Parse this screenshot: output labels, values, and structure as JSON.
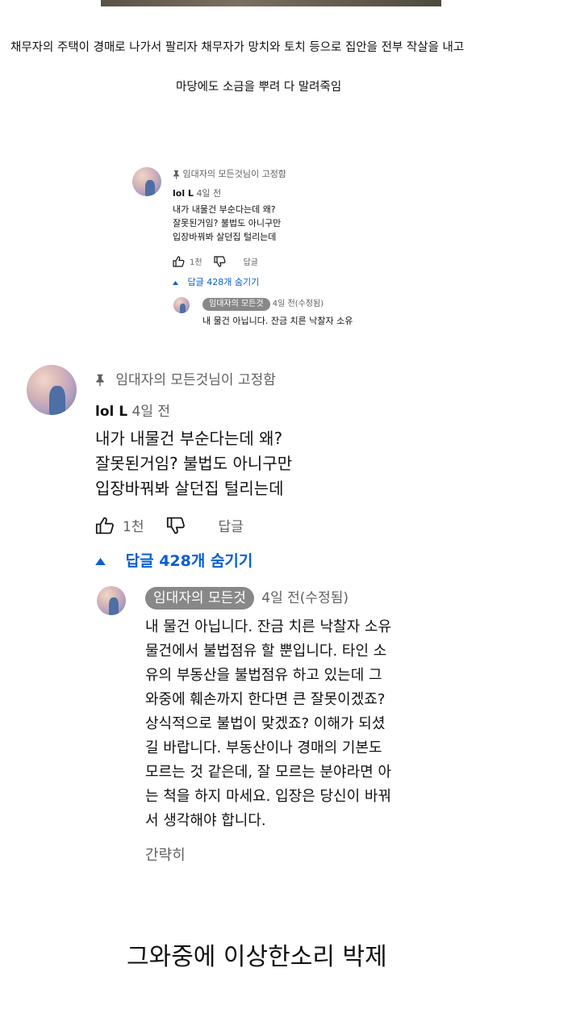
{
  "caption": {
    "line1": "채무자의 주택이 경매로 나가서 팔리자 채무자가 망치와 토치 등으로 집안을 전부 작살을 내고",
    "line2": "마당에도 소금을 뿌려 다 말려죽임"
  },
  "small_comment": {
    "pinned_label": "임대자의 모든것님이 고정함",
    "author": "lol L",
    "time": "4일 전",
    "lines": [
      "내가 내물건 부순다는데 왜?",
      "잘못된거임? 불법도 아니구만",
      "입장바꿔봐 살던집 털리는데"
    ],
    "like_count": "1천",
    "reply_label": "답글",
    "replies_toggle": "답글 428개 숨기기",
    "reply": {
      "author": "임대자의 모든것",
      "time": "4일 전(수정됨)",
      "text": "내 물건 아닙니다. 잔금 치른 낙찰자 소유"
    }
  },
  "large_comment": {
    "pinned_label": "임대자의 모든것님이 고정함",
    "author": "lol L",
    "time": "4일 전",
    "lines": [
      "내가 내물건 부순다는데 왜?",
      "잘못된거임? 불법도 아니구만",
      "입장바꿔봐 살던집 털리는데"
    ],
    "like_count": "1천",
    "reply_label": "답글",
    "replies_toggle": "답글 428개 숨기기",
    "reply": {
      "author": "임대자의 모든것",
      "time": "4일 전(수정됨)",
      "lines": [
        "내 물건 아닙니다. 잔금 치른 낙찰자 소유",
        "물건에서 불법점유 할 뿐입니다. 타인 소",
        "유의 부동산을 불법점유 하고 있는데 그",
        "와중에 훼손까지 한다면 큰 잘못이겠죠?",
        "상식적으로 불법이 맞겠죠? 이해가 되셨",
        "길 바랍니다.  부동산이나 경매의 기본도",
        "모르는 것 같은데, 잘 모르는 분야라면 아",
        "는 척을 하지 마세요. 입장은 당신이 바꿔",
        "서 생각해야 합니다."
      ],
      "show_less": "간략히"
    }
  },
  "bottom_caption": "그와중에 이상한소리 박제",
  "colors": {
    "link": "#065fd4",
    "muted": "#606060",
    "pill": "#888888"
  },
  "icons": [
    "pin-icon",
    "thumbs-up-icon",
    "thumbs-down-icon",
    "caret-up-icon"
  ]
}
